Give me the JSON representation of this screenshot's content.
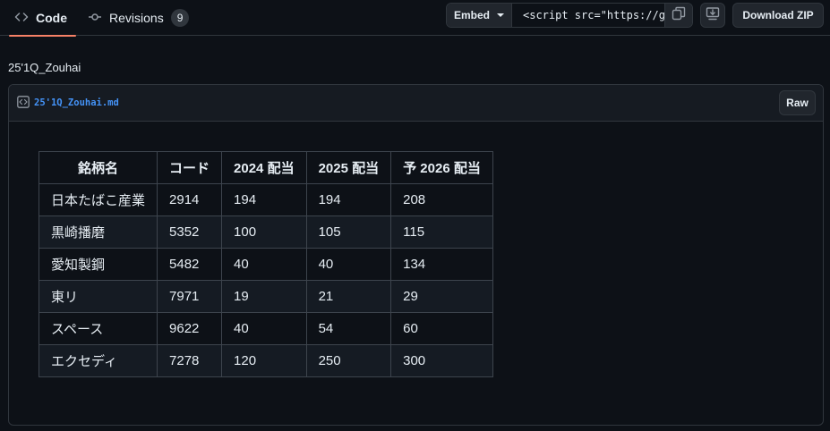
{
  "tabs": {
    "code_label": "Code",
    "revisions_label": "Revisions",
    "revisions_count": "9"
  },
  "toolbar": {
    "embed_label": "Embed",
    "embed_value": "<script src=\"https://g",
    "download_label": "Download ZIP",
    "icons": [
      "code-icon",
      "commit-icon",
      "copy-icon",
      "desktop-download-icon",
      "file-code-icon"
    ]
  },
  "gist": {
    "description": "25'1Q_Zouhai"
  },
  "file": {
    "name": "25'1Q_Zouhai.md",
    "raw_label": "Raw"
  },
  "table": {
    "headers": [
      "銘柄名",
      "コード",
      "2024 配当",
      "2025 配当",
      "予 2026 配当"
    ],
    "rows": [
      [
        "日本たばこ産業",
        "2914",
        "194",
        "194",
        "208"
      ],
      [
        "黒崎播磨",
        "5352",
        "100",
        "105",
        "115"
      ],
      [
        "愛知製鋼",
        "5482",
        "40",
        "40",
        "134"
      ],
      [
        "東リ",
        "7971",
        "19",
        "21",
        "29"
      ],
      [
        "スペース",
        "9622",
        "40",
        "54",
        "60"
      ],
      [
        "エクセディ",
        "7278",
        "120",
        "250",
        "300"
      ]
    ]
  }
}
